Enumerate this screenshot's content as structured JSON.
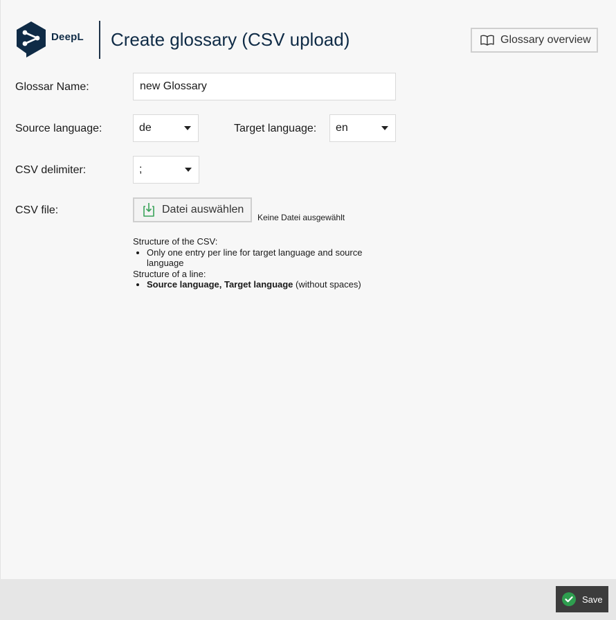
{
  "header": {
    "logo_text": "DeepL",
    "title": "Create glossary (CSV upload)",
    "overview_button": "Glossary overview"
  },
  "form": {
    "name_label": "Glossar Name:",
    "name_value": "new Glossary",
    "source_label": "Source language:",
    "source_value": "de",
    "target_label": "Target language:",
    "target_value": "en",
    "delimiter_label": "CSV delimiter:",
    "delimiter_value": ";",
    "file_label": "CSV file:",
    "file_button": "Datei auswählen",
    "file_status": "Keine Datei ausgewählt"
  },
  "help": {
    "structure_csv_title": "Structure of the CSV:",
    "csv_rule": "Only one entry per line for target language and source language",
    "structure_line_title": "Structure of a line:",
    "line_rule_bold": "Source language, Target language",
    "line_rule_note": " (without spaces)"
  },
  "footer": {
    "save_button": "Save"
  },
  "colors": {
    "brand_navy": "#0f2b46",
    "save_bg": "#3c3c3c",
    "check_green": "#2e9e4f",
    "upload_green": "#3aa35a"
  }
}
